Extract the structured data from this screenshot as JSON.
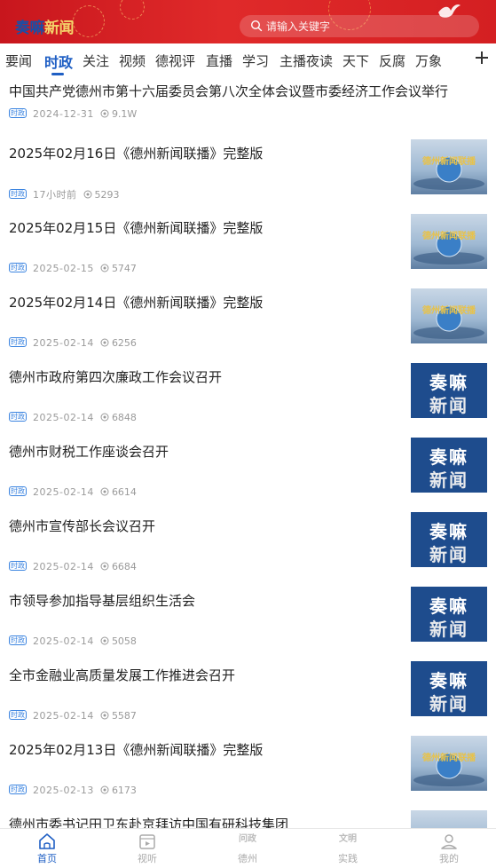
{
  "header": {
    "brand_part1": "奏嘛",
    "brand_part2": "新闻",
    "search_placeholder": "请输入关键字"
  },
  "tabs": [
    "要闻",
    "时政",
    "关注",
    "视频",
    "德视评",
    "直播",
    "学习",
    "主播夜读",
    "天下",
    "反腐",
    "万象"
  ],
  "active_tab": "时政",
  "feed": [
    {
      "title": "中国共产党德州市第十六届委员会第八次全体会议暨市委经济工作会议举行",
      "tag": "时政",
      "date": "2024-12-31",
      "views": "9.1W",
      "thumb": "none"
    },
    {
      "title": "2025年02月16日《德州新闻联播》完整版",
      "tag": "时政",
      "date": "17小时前",
      "views": "5293",
      "thumb": "news"
    },
    {
      "title": "2025年02月15日《德州新闻联播》完整版",
      "tag": "时政",
      "date": "2025-02-15",
      "views": "5747",
      "thumb": "news"
    },
    {
      "title": "2025年02月14日《德州新闻联播》完整版",
      "tag": "时政",
      "date": "2025-02-14",
      "views": "6256",
      "thumb": "news"
    },
    {
      "title": "德州市政府第四次廉政工作会议召开",
      "tag": "时政",
      "date": "2025-02-14",
      "views": "6848",
      "thumb": "zhi"
    },
    {
      "title": "德州市财税工作座谈会召开",
      "tag": "时政",
      "date": "2025-02-14",
      "views": "6614",
      "thumb": "zhi"
    },
    {
      "title": "德州市宣传部长会议召开",
      "tag": "时政",
      "date": "2025-02-14",
      "views": "6684",
      "thumb": "zhi"
    },
    {
      "title": "市领导参加指导基层组织生活会",
      "tag": "时政",
      "date": "2025-02-14",
      "views": "5058",
      "thumb": "zhi"
    },
    {
      "title": "全市金融业高质量发展工作推进会召开",
      "tag": "时政",
      "date": "2025-02-14",
      "views": "5587",
      "thumb": "zhi"
    },
    {
      "title": "2025年02月13日《德州新闻联播》完整版",
      "tag": "时政",
      "date": "2025-02-13",
      "views": "6173",
      "thumb": "news"
    },
    {
      "title": "德州市委书记田卫东赴京拜访中国有研科技集团",
      "tag": "",
      "date": "",
      "views": "",
      "thumb": "news"
    }
  ],
  "thumbs": {
    "zhi_line1": "奏嘛",
    "zhi_line2": "新闻",
    "news_caption": "德州新闻联播"
  },
  "bottom_nav": [
    {
      "label": "首页",
      "icon": "home-icon"
    },
    {
      "label": "视听",
      "icon": "video-icon"
    },
    {
      "label": "德州",
      "icon": "wenzheng-icon",
      "icon_text": "问政"
    },
    {
      "label": "实践",
      "icon": "wenming-icon",
      "icon_text": "文明"
    },
    {
      "label": "我的",
      "icon": "user-icon"
    }
  ],
  "active_nav": "首页",
  "colors": {
    "brand_red": "#d41f22",
    "accent_blue": "#1f5fc4",
    "thumb_blue": "#1e4c8d"
  }
}
